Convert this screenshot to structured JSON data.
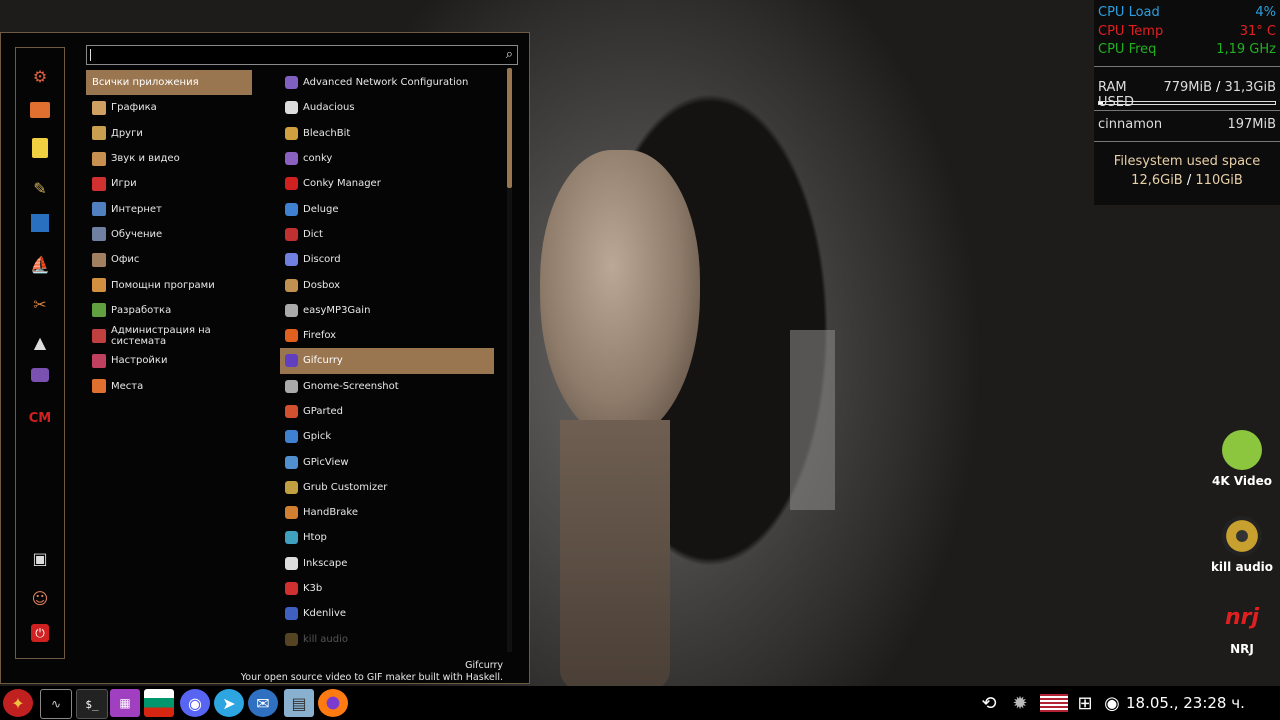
{
  "menu": {
    "search_value": "",
    "categories": [
      {
        "label": "Всички приложения",
        "color": "#9a7650"
      },
      {
        "label": "Графика",
        "color": "#d0a060"
      },
      {
        "label": "Други",
        "color": "#c8a050"
      },
      {
        "label": "Звук и видео",
        "color": "#c89050"
      },
      {
        "label": "Игри",
        "color": "#d03030"
      },
      {
        "label": "Интернет",
        "color": "#5080c0"
      },
      {
        "label": "Обучение",
        "color": "#7080a0"
      },
      {
        "label": "Офис",
        "color": "#a08060"
      },
      {
        "label": "Помощни програми",
        "color": "#d09040"
      },
      {
        "label": "Разработка",
        "color": "#60a040"
      },
      {
        "label": "Администрация на системата",
        "color": "#c04040"
      },
      {
        "label": "Настройки",
        "color": "#c04060"
      },
      {
        "label": "Места",
        "color": "#e07030"
      }
    ],
    "apps": [
      {
        "label": "Advanced Network Configuration",
        "color": "#8060c0"
      },
      {
        "label": "Audacious",
        "color": "#dddddd"
      },
      {
        "label": "BleachBit",
        "color": "#d0a040"
      },
      {
        "label": "conky",
        "color": "#8a60c0"
      },
      {
        "label": "Conky Manager",
        "color": "#d02020"
      },
      {
        "label": "Deluge",
        "color": "#4080d0"
      },
      {
        "label": "Dict",
        "color": "#c03030"
      },
      {
        "label": "Discord",
        "color": "#7080e0"
      },
      {
        "label": "Dosbox",
        "color": "#c09050"
      },
      {
        "label": "easyMP3Gain",
        "color": "#aaaaaa"
      },
      {
        "label": "Firefox",
        "color": "#e06020"
      },
      {
        "label": "Gifcurry",
        "color": "#6040c0"
      },
      {
        "label": "Gnome-Screenshot",
        "color": "#aaaaaa"
      },
      {
        "label": "GParted",
        "color": "#d05030"
      },
      {
        "label": "Gpick",
        "color": "#4080d0"
      },
      {
        "label": "GPicView",
        "color": "#5090d0"
      },
      {
        "label": "Grub Customizer",
        "color": "#c0a040"
      },
      {
        "label": "HandBrake",
        "color": "#d08030"
      },
      {
        "label": "Htop",
        "color": "#40a0c0"
      },
      {
        "label": "Inkscape",
        "color": "#dddddd"
      },
      {
        "label": "K3b",
        "color": "#d03030"
      },
      {
        "label": "Kdenlive",
        "color": "#4060c0"
      },
      {
        "label": "kill audio",
        "color": "#554422"
      }
    ],
    "selected_description": {
      "title": "Gifcurry",
      "text": "Your open source video to GIF maker built with Haskell."
    },
    "favorites": [
      "settings-icon",
      "folder-icon",
      "text-editor-icon",
      "paint-icon",
      "system-monitor-icon",
      "ship-icon",
      "tools-icon",
      "inkscape-icon",
      "conky-icon",
      "conky-manager-icon"
    ],
    "session": [
      "lock-screen-icon",
      "logout-icon",
      "shutdown-icon"
    ]
  },
  "conky": {
    "cpu_load_label": "CPU Load",
    "cpu_load_value": "4%",
    "cpu_temp_label": "CPU Temp",
    "cpu_temp_value": "31° C",
    "cpu_freq_label": "CPU Freq",
    "cpu_freq_value": "1,19 GHz",
    "ram_label": "RAM USED",
    "ram_used": "779MiB",
    "ram_sep": "/",
    "ram_total": "31,3GiB",
    "ram_fraction": 0.024,
    "process_name": "cinnamon",
    "process_mem": "197MiB",
    "fs_title": "Filesystem used space",
    "fs_used": "12,6GiB",
    "fs_sep": "/",
    "fs_total": "110GiB",
    "colors": {
      "load": "#2aa0e0",
      "temp": "#e02020",
      "freq": "#20b020",
      "fs": "#e8d0a8"
    }
  },
  "desktop_icons": [
    {
      "label": "4K Video",
      "icon": "4k-video-downloader-icon"
    },
    {
      "label": "kill audio",
      "icon": "speaker-icon"
    },
    {
      "label": "NRJ",
      "icon": "nrj-radio-icon"
    }
  ],
  "taskbar": {
    "apps": [
      "menu-icon",
      "system-monitor-icon",
      "terminal-icon",
      "calculator-icon",
      "keyboard-layout-icon",
      "discord-icon",
      "telegram-icon",
      "mail-icon",
      "files-icon",
      "firefox-icon"
    ],
    "tray": [
      "refresh-icon",
      "settings-icon",
      "us-flag-icon",
      "network-icon",
      "media-icon"
    ],
    "clock": "18.05., 23:28 ч."
  }
}
